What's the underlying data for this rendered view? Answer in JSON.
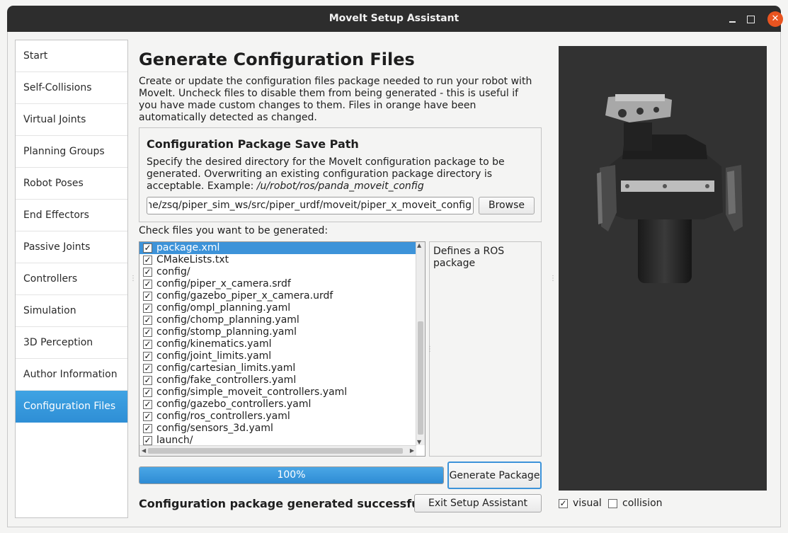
{
  "window": {
    "title": "MoveIt Setup Assistant"
  },
  "sidebar": {
    "items": [
      {
        "label": "Start"
      },
      {
        "label": "Self-Collisions"
      },
      {
        "label": "Virtual Joints"
      },
      {
        "label": "Planning Groups"
      },
      {
        "label": "Robot Poses"
      },
      {
        "label": "End Effectors"
      },
      {
        "label": "Passive Joints"
      },
      {
        "label": "Controllers"
      },
      {
        "label": "Simulation"
      },
      {
        "label": "3D Perception"
      },
      {
        "label": "Author Information"
      },
      {
        "label": "Configuration Files"
      }
    ],
    "active_index": 11
  },
  "main": {
    "title": "Generate Configuration Files",
    "description": "Create or update the configuration files package needed to run your robot with MoveIt. Uncheck files to disable them from being generated - this is useful if you have made custom changes to them. Files in orange have been automatically detected as changed.",
    "save_path": {
      "title": "Configuration Package Save Path",
      "description_prefix": "Specify the desired directory for the MoveIt configuration package to be generated. Overwriting an existing configuration package directory is acceptable. Example: ",
      "description_example": "/u/robot/ros/panda_moveit_config",
      "value": "ne/zsq/piper_sim_ws/src/piper_urdf/moveit/piper_x_moveit_config",
      "browse_label": "Browse"
    },
    "files_label": "Check files you want to be generated:",
    "files": [
      {
        "name": "package.xml",
        "checked": true
      },
      {
        "name": "CMakeLists.txt",
        "checked": true
      },
      {
        "name": "config/",
        "checked": true
      },
      {
        "name": "config/piper_x_camera.srdf",
        "checked": true
      },
      {
        "name": "config/gazebo_piper_x_camera.urdf",
        "checked": true
      },
      {
        "name": "config/ompl_planning.yaml",
        "checked": true
      },
      {
        "name": "config/chomp_planning.yaml",
        "checked": true
      },
      {
        "name": "config/stomp_planning.yaml",
        "checked": true
      },
      {
        "name": "config/kinematics.yaml",
        "checked": true
      },
      {
        "name": "config/joint_limits.yaml",
        "checked": true
      },
      {
        "name": "config/cartesian_limits.yaml",
        "checked": true
      },
      {
        "name": "config/fake_controllers.yaml",
        "checked": true
      },
      {
        "name": "config/simple_moveit_controllers.yaml",
        "checked": true
      },
      {
        "name": "config/gazebo_controllers.yaml",
        "checked": true
      },
      {
        "name": "config/ros_controllers.yaml",
        "checked": true
      },
      {
        "name": "config/sensors_3d.yaml",
        "checked": true
      },
      {
        "name": "launch/",
        "checked": true
      }
    ],
    "selected_file_index": 0,
    "file_description": "Defines a ROS package",
    "progress": {
      "value": 100,
      "label": "100%"
    },
    "generate_label": "Generate Package",
    "status": "Configuration package generated successfully!",
    "exit_label": "Exit Setup Assistant"
  },
  "viewer": {
    "visual_label": "visual",
    "visual_checked": true,
    "collision_label": "collision",
    "collision_checked": false
  },
  "colors": {
    "accent": "#3d93d9",
    "titlebar": "#2d2d2d",
    "close": "#e95420",
    "viewer_bg": "#323232"
  }
}
